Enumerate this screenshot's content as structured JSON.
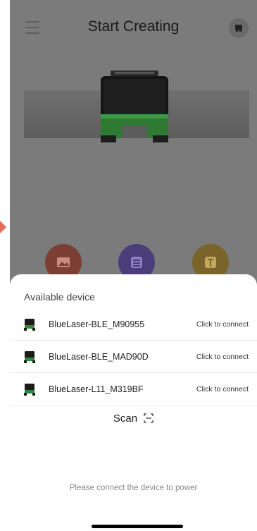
{
  "header": {
    "title": "Start Creating",
    "menu_icon": "hamburger-menu-icon",
    "profile_icon": "device-profile-icon"
  },
  "hero": {
    "image": "laser-engraver-device-image"
  },
  "quick_actions": [
    {
      "icon": "image-icon",
      "color": "#7c3f34"
    },
    {
      "icon": "list-icon",
      "color": "#4b3d7a"
    },
    {
      "icon": "text-icon",
      "color": "#7a6429"
    }
  ],
  "sheet": {
    "title": "Available device",
    "devices": [
      {
        "name": "BlueLaser-BLE_M90955",
        "action": "Click to connect"
      },
      {
        "name": "BlueLaser-BLE_MAD90D",
        "action": "Click to connect"
      },
      {
        "name": "BlueLaser-L11_M319BF",
        "action": "Click to connect"
      }
    ],
    "scan_label": "Scan",
    "hint": "Please connect the device to power"
  },
  "colors": {
    "overlay": "#7b7b7b",
    "sheet_bg": "#ffffff",
    "device_green": "#2f8a3a",
    "accent_arrow": "#ea6a5a"
  }
}
